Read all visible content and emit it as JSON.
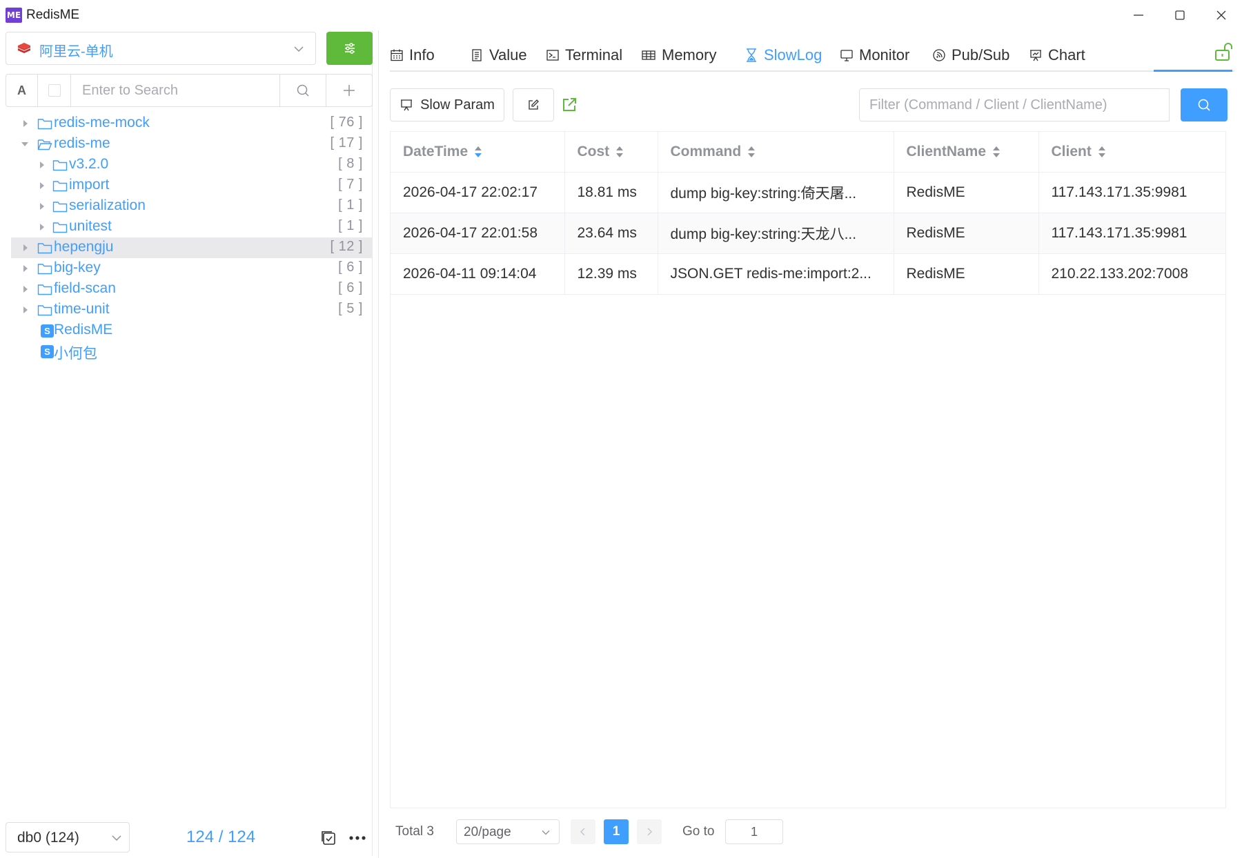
{
  "window": {
    "logo_text": "ME",
    "title": "RedisME"
  },
  "sidebar": {
    "connection": "阿里云-单机",
    "search": {
      "type_toggle": "A",
      "placeholder": "Enter to Search"
    },
    "tree": [
      {
        "label": "redis-me-mock",
        "count": "[ 76 ]",
        "kind": "folder",
        "expanded": false,
        "level": 0
      },
      {
        "label": "redis-me",
        "count": "[ 17 ]",
        "kind": "folder",
        "expanded": true,
        "level": 0
      },
      {
        "label": "v3.2.0",
        "count": "[ 8 ]",
        "kind": "folder",
        "expanded": false,
        "level": 1
      },
      {
        "label": "import",
        "count": "[ 7 ]",
        "kind": "folder",
        "expanded": false,
        "level": 1
      },
      {
        "label": "serialization",
        "count": "[ 1 ]",
        "kind": "folder",
        "expanded": false,
        "level": 1
      },
      {
        "label": "unitest",
        "count": "[ 1 ]",
        "kind": "folder",
        "expanded": false,
        "level": 1
      },
      {
        "label": "hepengju",
        "count": "[ 12 ]",
        "kind": "folder",
        "expanded": false,
        "level": 0,
        "selected": true
      },
      {
        "label": "big-key",
        "count": "[ 6 ]",
        "kind": "folder",
        "expanded": false,
        "level": 0
      },
      {
        "label": "field-scan",
        "count": "[ 6 ]",
        "kind": "folder",
        "expanded": false,
        "level": 0
      },
      {
        "label": "time-unit",
        "count": "[ 5 ]",
        "kind": "folder",
        "expanded": false,
        "level": 0
      },
      {
        "label": "RedisME",
        "kind": "string",
        "badge": "S",
        "level": 0
      },
      {
        "label": "小何包",
        "kind": "string",
        "badge": "S",
        "level": 0
      }
    ],
    "footer": {
      "db": "db0 (124)",
      "key_count": "124 / 124"
    }
  },
  "tabs": [
    {
      "label": "Info",
      "icon": "calendar-icon"
    },
    {
      "label": "Value",
      "icon": "document-icon"
    },
    {
      "label": "Terminal",
      "icon": "terminal-icon"
    },
    {
      "label": "Memory",
      "icon": "grid-icon"
    },
    {
      "label": "SlowLog",
      "icon": "hourglass-icon",
      "active": true
    },
    {
      "label": "Monitor",
      "icon": "monitor-icon"
    },
    {
      "label": "Pub/Sub",
      "icon": "broadcast-icon"
    },
    {
      "label": "Chart",
      "icon": "chart-icon"
    }
  ],
  "slowlog": {
    "slow_param_label": "Slow Param",
    "filter_placeholder": "Filter (Command / Client / ClientName)",
    "columns": [
      "DateTime",
      "Cost",
      "Command",
      "ClientName",
      "Client"
    ],
    "rows": [
      {
        "datetime": "2026-04-17 22:02:17",
        "cost": "18.81 ms",
        "command": "dump big-key:string:倚天屠...",
        "client_name": "RedisME",
        "client": "117.143.171.35:9981"
      },
      {
        "datetime": "2026-04-17 22:01:58",
        "cost": "23.64 ms",
        "command": "dump big-key:string:天龙八...",
        "client_name": "RedisME",
        "client": "117.143.171.35:9981"
      },
      {
        "datetime": "2026-04-11 09:14:04",
        "cost": "12.39 ms",
        "command": "JSON.GET redis-me:import:2...",
        "client_name": "RedisME",
        "client": "210.22.133.202:7008"
      }
    ]
  },
  "pagination": {
    "total": "Total 3",
    "page_size": "20/page",
    "current_page": "1",
    "goto_label": "Go to",
    "goto_value": "1"
  },
  "colors": {
    "accent": "#409eff",
    "green": "#5fba3c",
    "brand_logo": "#6f3fd6"
  }
}
